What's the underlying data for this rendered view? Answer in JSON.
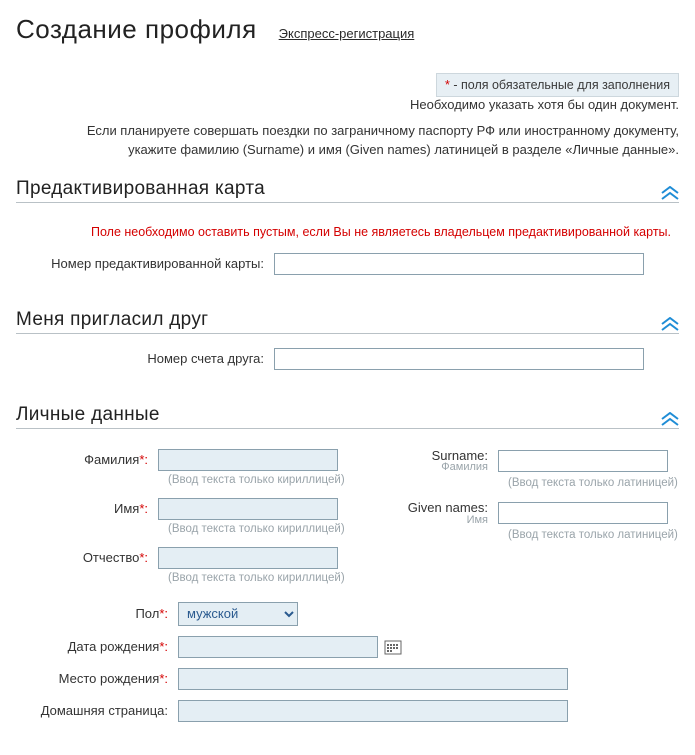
{
  "header": {
    "title": "Создание профиля",
    "express_link": "Экспресс-регистрация"
  },
  "notes": {
    "required_star": "*",
    "required_text": " - поля обязательные для заполнения",
    "doc_note": "Необходимо указать хотя бы один документ.",
    "travel_note_1": "Если планируете совершать поездки по заграничному паспорту РФ или иностранному документу,",
    "travel_note_2": "укажите фамилию (Surname) и имя (Given names) латиницей в разделе «Личные данные»."
  },
  "sections": {
    "preactivated": {
      "title": "Предактивированная карта",
      "warning": "Поле необходимо оставить пустым, если Вы не являетесь владельцем предактивированной карты.",
      "number_label": "Номер предактивированной карты:"
    },
    "friend": {
      "title": "Меня пригласил друг",
      "number_label": "Номер счета друга:"
    },
    "personal": {
      "title": "Личные данные",
      "surname_ru_label": "Фамилия",
      "name_ru_label": "Имя",
      "patronymic_label": "Отчество",
      "hint_cyr": "(Ввод текста только кириллицей)",
      "surname_en": {
        "label": "Surname:",
        "sub": "Фамилия"
      },
      "given_en": {
        "label": "Given names:",
        "sub": "Имя"
      },
      "hint_lat": "(Ввод текста только латиницей)",
      "gender_label": "Пол",
      "gender_value": "мужской",
      "dob_label": "Дата рождения",
      "pob_label": "Место рождения",
      "homepage_label": "Домашняя страница"
    }
  },
  "punct": {
    "star_colon": "*:",
    "colon": ":"
  }
}
